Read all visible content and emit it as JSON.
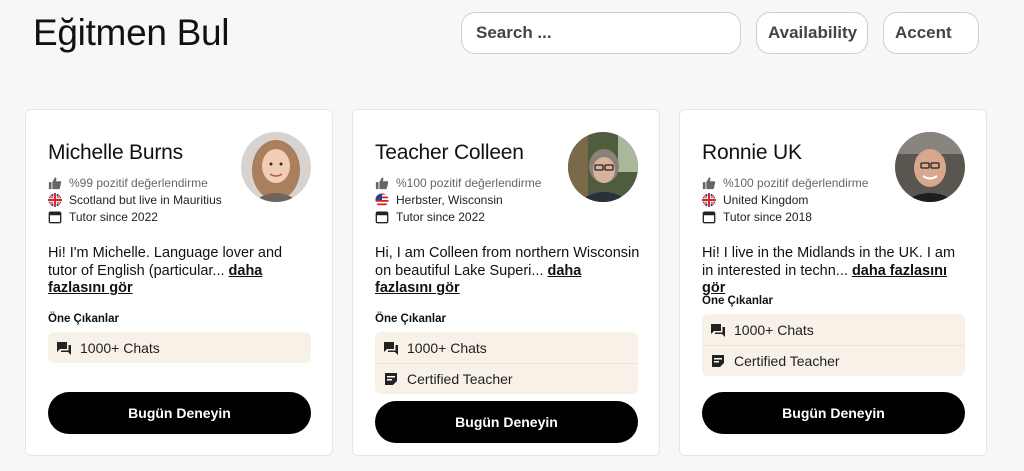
{
  "header": {
    "title": "Eğitmen Bul",
    "search_placeholder": "Search ...",
    "availability_label": "Availability",
    "accent_label": "Accent"
  },
  "tutors": [
    {
      "name": "Michelle Burns",
      "rating": "%99 pozitif değerlendirme",
      "location": "Scotland but live in Mauritius",
      "location_flag": "uk-flag",
      "since": "Tutor since 2022",
      "bio": "Hi! I'm Michelle. Language lover and tutor of English (particular...",
      "more_link": "daha fazlasını gör",
      "highlights_title": "Öne Çıkanlar",
      "highlights": [
        {
          "icon": "chat-icon",
          "label": "1000+ Chats"
        }
      ],
      "cta": "Bugün Deneyin"
    },
    {
      "name": "Teacher Colleen",
      "rating": "%100 pozitif değerlendirme",
      "location": "Herbster, Wisconsin",
      "location_flag": "us-flag",
      "since": "Tutor since 2022",
      "bio": "Hi, I am Colleen from northern Wisconsin on beautiful Lake Superi...",
      "more_link": "daha fazlasını gör",
      "highlights_title": "Öne Çıkanlar",
      "highlights": [
        {
          "icon": "chat-icon",
          "label": "1000+ Chats"
        },
        {
          "icon": "certificate-icon",
          "label": "Certified Teacher"
        }
      ],
      "cta": "Bugün Deneyin"
    },
    {
      "name": "Ronnie UK",
      "rating": "%100 pozitif değerlendirme",
      "location": "United Kingdom",
      "location_flag": "uk-flag",
      "since": "Tutor since 2018",
      "bio": "Hi! I live in the Midlands in the UK. I am in interested in techn...",
      "more_link": "daha fazlasını gör",
      "highlights_title": "Öne Çıkanlar",
      "highlights": [
        {
          "icon": "chat-icon",
          "label": "1000+ Chats"
        },
        {
          "icon": "certificate-icon",
          "label": "Certified Teacher"
        }
      ],
      "cta": "Bugün Deneyin"
    }
  ]
}
